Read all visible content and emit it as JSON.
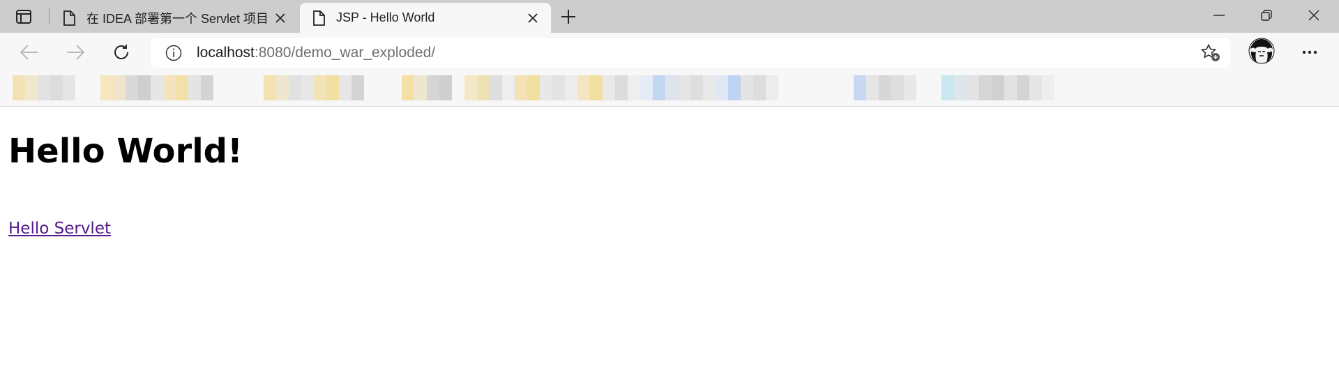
{
  "browser": {
    "tabs": [
      {
        "title": "在 IDEA 部署第一个 Servlet 项目",
        "active": false
      },
      {
        "title": "JSP - Hello World",
        "active": true
      }
    ],
    "address_bar": {
      "host": "localhost",
      "path": ":8080/demo_war_exploded/"
    }
  },
  "page": {
    "heading": "Hello World!",
    "link_text": "Hello Servlet",
    "link_color": "#551a8b"
  },
  "icons": [
    "tab-actions-icon",
    "page-icon",
    "close-icon",
    "plus-icon",
    "minimize-icon",
    "restore-icon",
    "back-arrow-icon",
    "forward-arrow-icon",
    "refresh-icon",
    "info-icon",
    "add-favorite-icon",
    "avatar",
    "more-icon"
  ]
}
